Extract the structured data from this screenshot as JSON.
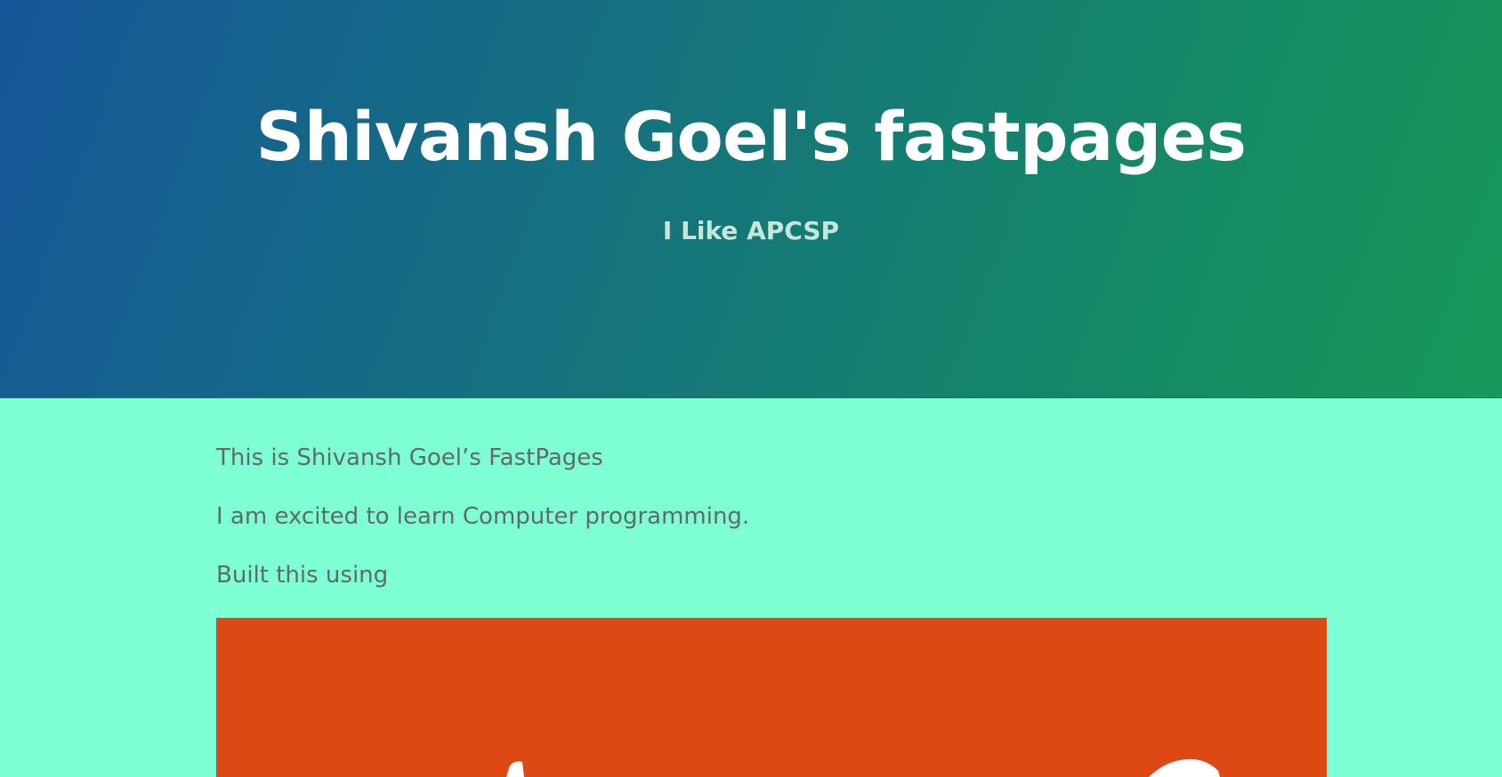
{
  "header": {
    "title": "Shivansh Goel's fastpages",
    "tagline": "I Like APCSP"
  },
  "main": {
    "paragraphs": [
      "This is Shivansh Goel’s FastPages",
      "I am excited to learn Computer programming.",
      "Built this using"
    ],
    "image": {
      "background_color": "#dd4814",
      "description": "fastpages-logo"
    }
  },
  "colors": {
    "hero_gradient_start": "#155799",
    "hero_gradient_end": "#159957",
    "content_background": "#7fffd4",
    "text": "#5d6b6b"
  }
}
